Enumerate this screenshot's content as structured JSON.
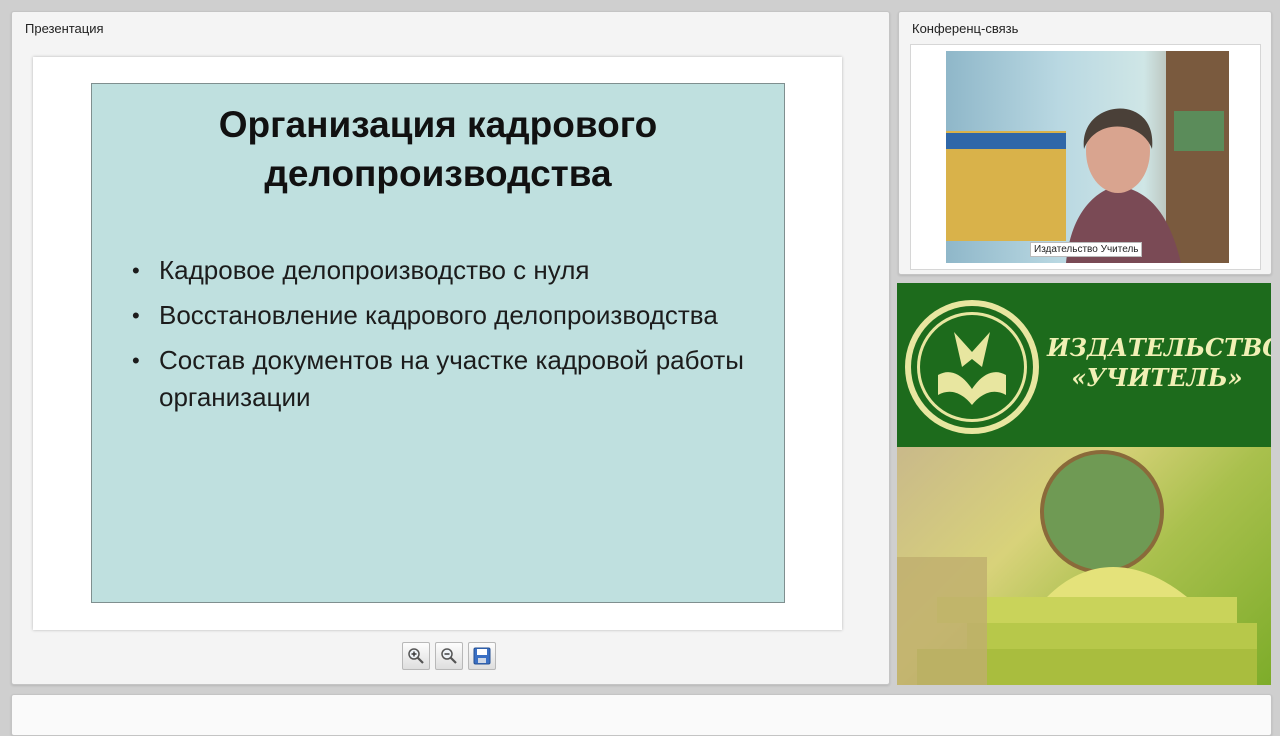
{
  "presentation_panel": {
    "title": "Презентация",
    "slide": {
      "title_lines": [
        "Организация  кадрового",
        "делопроизводства"
      ],
      "bullets": [
        "Кадровое делопроизводство с нуля",
        "Восстановление кадрового делопроизводства",
        "Состав документов на участке кадровой работы организации"
      ]
    },
    "toolbar": {
      "zoom_in_icon": "zoom-in-icon",
      "zoom_out_icon": "zoom-out-icon",
      "save_icon": "save-icon"
    }
  },
  "conference_panel": {
    "title": "Конференц-связь",
    "speaker_name": "Издательство Учитель"
  },
  "publisher_banner": {
    "title_lines": [
      "ИЗДАТЕЛЬСТВО",
      "«УЧИТЕЛЬ»"
    ]
  },
  "colors": {
    "slide_background": "#bfe0df",
    "banner_green": "#1d6b1c",
    "banner_text": "#f1f0b5"
  }
}
